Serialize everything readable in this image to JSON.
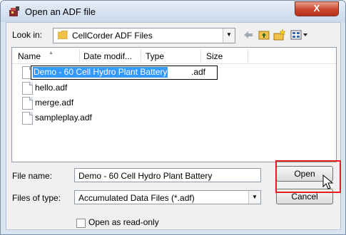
{
  "window": {
    "title": "Open an ADF file",
    "close_glyph": "X"
  },
  "look_in": {
    "label": "Look in:",
    "value": "CellCorder ADF Files"
  },
  "file_list": {
    "columns": [
      "Name",
      "Date modif...",
      "Type",
      "Size"
    ],
    "files": [
      {
        "name": "Demo - 60 Cell Hydro Plant Battery",
        "ext": ".adf"
      },
      {
        "name": "hello.adf"
      },
      {
        "name": "merge.adf"
      },
      {
        "name": "sampleplay.adf"
      }
    ]
  },
  "file_name": {
    "label": "File name:",
    "value": "Demo - 60 Cell Hydro Plant Battery"
  },
  "files_of_type": {
    "label": "Files of type:",
    "value": "Accumulated Data Files (*.adf)"
  },
  "buttons": {
    "open": "Open",
    "cancel": "Cancel"
  },
  "read_only": {
    "label": "Open as read-only",
    "checked": false
  },
  "icons": {
    "app": "app-icon",
    "folder": "folder-icon",
    "back": "back-arrow-icon",
    "up": "up-folder-icon",
    "new_folder": "new-folder-icon",
    "view": "view-menu-icon"
  },
  "colors": {
    "selection": "#3399ff",
    "highlight": "#e02020",
    "close": "#c9452c"
  }
}
